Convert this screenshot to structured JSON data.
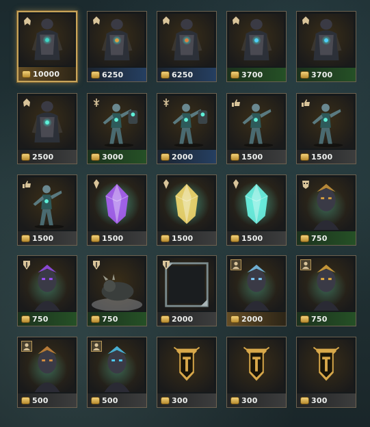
{
  "store": {
    "currency_icon": "gold-coin-icon",
    "items": [
      {
        "price": "10000",
        "badge": "ornate-cloak-icon",
        "art": "champion",
        "tone": "gold",
        "accent": "#3fd6c6",
        "bar": "gold",
        "selected": true
      },
      {
        "price": "6250",
        "badge": "ornate-cloak-icon",
        "art": "champion",
        "tone": "red",
        "accent": "#e0a040",
        "bar": "blue"
      },
      {
        "price": "6250",
        "badge": "ornate-cloak-icon",
        "art": "champion",
        "tone": "red",
        "accent": "#e08040",
        "bar": "blue"
      },
      {
        "price": "3700",
        "badge": "ornate-cloak-icon",
        "art": "champion",
        "tone": "blue",
        "accent": "#4fd0ff",
        "bar": "green"
      },
      {
        "price": "3700",
        "badge": "ornate-cloak-icon",
        "art": "champion",
        "tone": "blue",
        "accent": "#4fd0ff",
        "bar": "green"
      },
      {
        "price": "2500",
        "badge": "ornate-cloak-icon",
        "art": "champion",
        "tone": "teal",
        "accent": "#5ff0d8",
        "bar": "gray"
      },
      {
        "price": "3000",
        "badge": "emote-gesture-icon",
        "art": "emote",
        "tone": "teal",
        "accent": "#5ff0d8",
        "bar": "green"
      },
      {
        "price": "2000",
        "badge": "emote-gesture-icon",
        "art": "emote",
        "tone": "teal",
        "accent": "#5ff0d8",
        "bar": "blue"
      },
      {
        "price": "1500",
        "badge": "thumbs-up-icon",
        "art": "pose",
        "tone": "teal",
        "accent": "#5ff0d8",
        "bar": "gray"
      },
      {
        "price": "1500",
        "badge": "thumbs-up-icon",
        "art": "pose",
        "tone": "teal",
        "accent": "#5ff0d8",
        "bar": "gray"
      },
      {
        "price": "1500",
        "badge": "thumbs-up-icon",
        "art": "pose",
        "tone": "teal",
        "accent": "#5ff0d8",
        "bar": "gray"
      },
      {
        "price": "1500",
        "badge": "crystal-shard-icon",
        "art": "crystal",
        "tone": "purple",
        "accent": "#b060ff",
        "bar": "gray"
      },
      {
        "price": "1500",
        "badge": "crystal-shard-icon",
        "art": "crystal",
        "tone": "yellow",
        "accent": "#ffe070",
        "bar": "gray"
      },
      {
        "price": "1500",
        "badge": "crystal-shard-icon",
        "art": "crystal",
        "tone": "cyan",
        "accent": "#70fff0",
        "bar": "gray"
      },
      {
        "price": "750",
        "badge": "mask-icon",
        "art": "portrait",
        "tone": "purple",
        "accent": "#d8a040",
        "bar": "green"
      },
      {
        "price": "750",
        "badge": "shield-crest-icon",
        "art": "portrait",
        "tone": "purple",
        "accent": "#a050ff",
        "bar": "green"
      },
      {
        "price": "750",
        "badge": "shield-crest-icon",
        "art": "beast",
        "tone": "gray",
        "accent": "#cfcfcf",
        "bar": "green"
      },
      {
        "price": "2000",
        "badge": "shield-crest-icon",
        "art": "frame",
        "tone": "gray",
        "accent": "#9aa6a8",
        "bar": "gray"
      },
      {
        "price": "2000",
        "badge": "profile-icon",
        "art": "portrait",
        "tone": "purple",
        "accent": "#7fd0ff",
        "bar": "gold"
      },
      {
        "price": "750",
        "badge": "profile-icon",
        "art": "portrait",
        "tone": "red",
        "accent": "#e8b040",
        "bar": "green"
      },
      {
        "price": "500",
        "badge": "profile-icon",
        "art": "portrait",
        "tone": "teal",
        "accent": "#d89040",
        "bar": "gray"
      },
      {
        "price": "500",
        "badge": "profile-icon",
        "art": "portrait",
        "tone": "blue",
        "accent": "#4fd0ff",
        "bar": "gray"
      },
      {
        "price": "300",
        "badge": "",
        "art": "banner",
        "tone": "dark",
        "accent": "#d8a84a",
        "bar": "gray"
      },
      {
        "price": "300",
        "badge": "",
        "art": "banner",
        "tone": "dark",
        "accent": "#d8a84a",
        "bar": "gray"
      },
      {
        "price": "300",
        "badge": "",
        "art": "banner",
        "tone": "dark",
        "accent": "#d8a84a",
        "bar": "gray"
      }
    ]
  }
}
